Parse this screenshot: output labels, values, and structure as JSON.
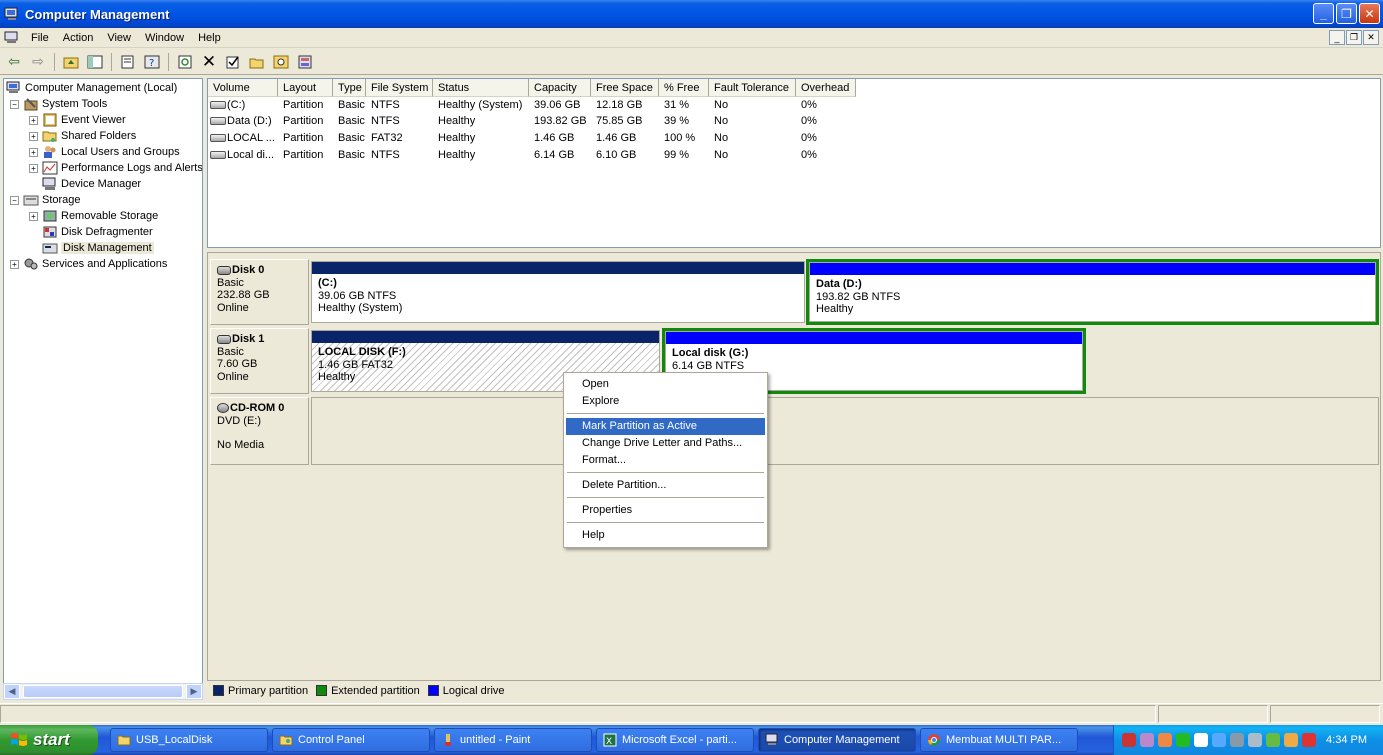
{
  "window": {
    "title": "Computer Management",
    "colors": {
      "titlebar": "#0055E5",
      "selection": "#316AC5"
    }
  },
  "menu": [
    "File",
    "Action",
    "View",
    "Window",
    "Help"
  ],
  "toolbar": {
    "icons": [
      "back-arrow-icon",
      "forward-arrow-icon",
      "up-folder-icon",
      "show-hide-tree-icon",
      "properties-icon",
      "help-icon",
      "refresh-icon",
      "delete-icon",
      "check-icon",
      "open-icon",
      "search-icon",
      "settings-icon"
    ]
  },
  "tree": [
    {
      "label": "Computer Management (Local)",
      "level": 0,
      "expander": "",
      "icon": "computer-icon"
    },
    {
      "label": "System Tools",
      "level": 1,
      "expander": "−",
      "icon": "tools-icon"
    },
    {
      "label": "Event Viewer",
      "level": 2,
      "expander": "+",
      "icon": "event-viewer-icon"
    },
    {
      "label": "Shared Folders",
      "level": 2,
      "expander": "+",
      "icon": "shared-folder-icon"
    },
    {
      "label": "Local Users and Groups",
      "level": 2,
      "expander": "+",
      "icon": "users-icon"
    },
    {
      "label": "Performance Logs and Alerts",
      "level": 2,
      "expander": "+",
      "icon": "performance-icon"
    },
    {
      "label": "Device Manager",
      "level": 2,
      "expander": "",
      "icon": "device-manager-icon"
    },
    {
      "label": "Storage",
      "level": 1,
      "expander": "−",
      "icon": "storage-icon"
    },
    {
      "label": "Removable Storage",
      "level": 2,
      "expander": "+",
      "icon": "removable-storage-icon"
    },
    {
      "label": "Disk Defragmenter",
      "level": 2,
      "expander": "",
      "icon": "defrag-icon"
    },
    {
      "label": "Disk Management",
      "level": 2,
      "expander": "",
      "icon": "disk-management-icon",
      "selected": true
    },
    {
      "label": "Services and Applications",
      "level": 1,
      "expander": "+",
      "icon": "services-icon"
    }
  ],
  "volumes": {
    "columns": [
      "Volume",
      "Layout",
      "Type",
      "File System",
      "Status",
      "Capacity",
      "Free Space",
      "% Free",
      "Fault Tolerance",
      "Overhead"
    ],
    "rows": [
      [
        "(C:)",
        "Partition",
        "Basic",
        "NTFS",
        "Healthy (System)",
        "39.06 GB",
        "12.18 GB",
        "31 %",
        "No",
        "0%"
      ],
      [
        "Data (D:)",
        "Partition",
        "Basic",
        "NTFS",
        "Healthy",
        "193.82 GB",
        "75.85 GB",
        "39 %",
        "No",
        "0%"
      ],
      [
        "LOCAL ...",
        "Partition",
        "Basic",
        "FAT32",
        "Healthy",
        "1.46 GB",
        "1.46 GB",
        "100 %",
        "No",
        "0%"
      ],
      [
        "Local di...",
        "Partition",
        "Basic",
        "NTFS",
        "Healthy",
        "6.14 GB",
        "6.10 GB",
        "99 %",
        "No",
        "0%"
      ]
    ]
  },
  "disks": [
    {
      "name": "Disk 0",
      "type": "Basic",
      "size": "232.88 GB",
      "status": "Online",
      "partitions": [
        {
          "name": "(C:)",
          "size": "39.06 GB NTFS",
          "status": "Healthy (System)",
          "kind": "primary",
          "color": "#0A246A"
        },
        {
          "name": "Data  (D:)",
          "size": "193.82 GB NTFS",
          "status": "Healthy",
          "kind": "logical",
          "color": "#0000FF"
        }
      ]
    },
    {
      "name": "Disk 1",
      "type": "Basic",
      "size": "7.60 GB",
      "status": "Online",
      "partitions": [
        {
          "name": "LOCAL DISK  (F:)",
          "size": "1.46 GB FAT32",
          "status": "Healthy",
          "kind": "primary",
          "color": "#0A246A"
        },
        {
          "name": "Local disk  (G:)",
          "size": "6.14 GB NTFS",
          "status": "",
          "kind": "logical",
          "color": "#0000FF"
        }
      ]
    },
    {
      "name": "CD-ROM 0",
      "type": "DVD (E:)",
      "size": "",
      "status": "No Media",
      "partitions": []
    }
  ],
  "legend": [
    {
      "label": "Primary partition",
      "color": "#0A246A"
    },
    {
      "label": "Extended partition",
      "color": "#0F8A0F"
    },
    {
      "label": "Logical drive",
      "color": "#0000FF"
    }
  ],
  "context_menu": {
    "items": [
      "Open",
      "Explore",
      "Mark Partition as Active",
      "Change Drive Letter and Paths...",
      "Format...",
      "Delete Partition...",
      "Properties",
      "Help"
    ],
    "highlighted": "Mark Partition as Active"
  },
  "taskbar": {
    "start_label": "start",
    "tasks": [
      {
        "label": "USB_LocalDisk",
        "icon": "folder-icon"
      },
      {
        "label": "Control Panel",
        "icon": "control-panel-icon"
      },
      {
        "label": "untitled - Paint",
        "icon": "paint-icon"
      },
      {
        "label": "Microsoft Excel - parti...",
        "icon": "excel-icon"
      },
      {
        "label": "Computer Management",
        "icon": "computer-management-icon",
        "active": true
      },
      {
        "label": "Membuat MULTI PAR...",
        "icon": "chrome-icon"
      }
    ],
    "clock": "4:34 PM"
  }
}
